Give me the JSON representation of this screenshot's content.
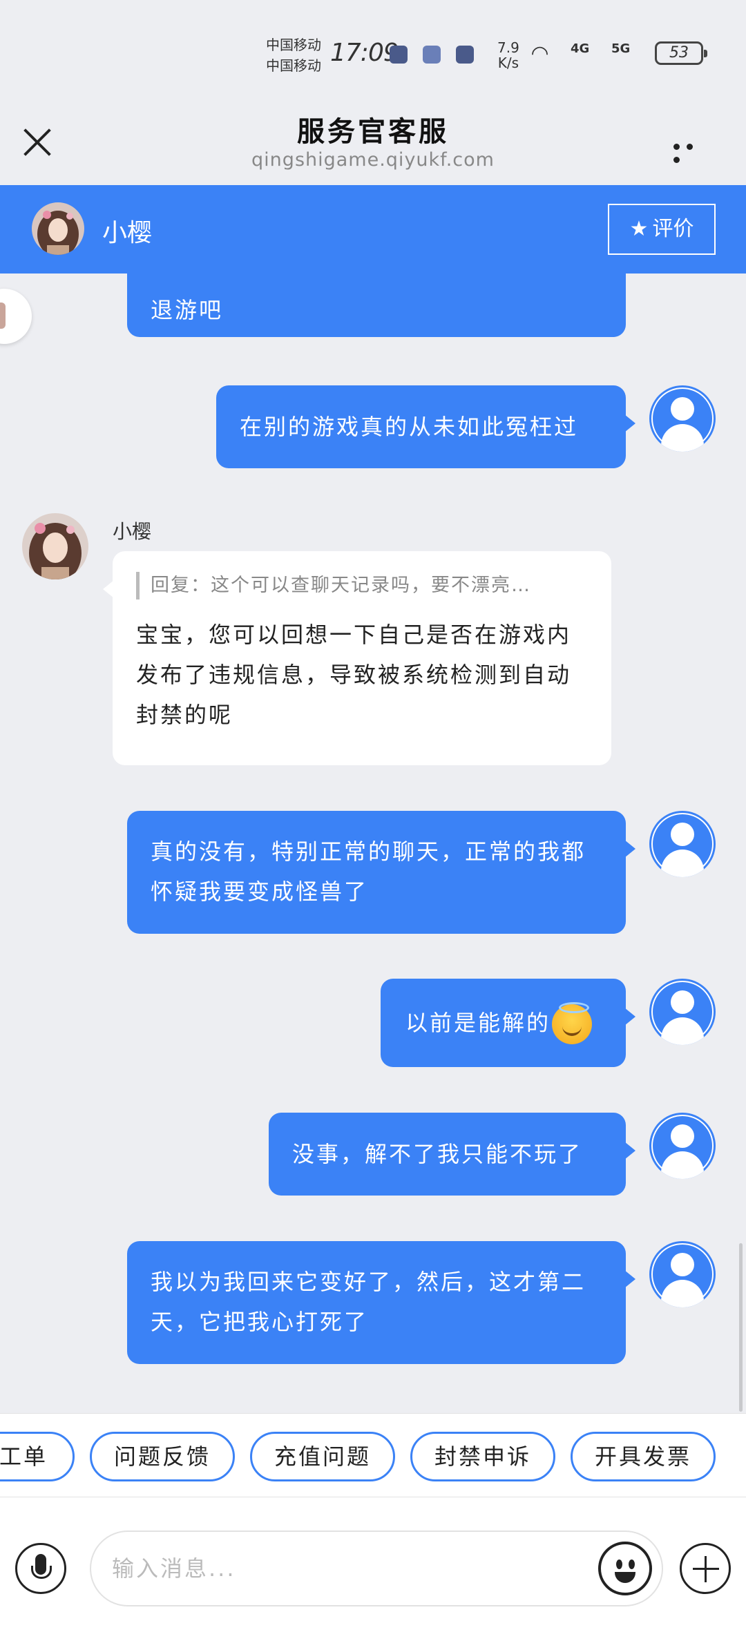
{
  "status_bar": {
    "carrier1": "中国移动",
    "carrier2": "中国移动",
    "time": "17:09",
    "net_speed_value": "7.9",
    "net_speed_unit": "K/s",
    "signal1": "4G",
    "signal2": "5G",
    "battery": "53"
  },
  "header": {
    "title": "服务官客服",
    "url": "qingshigame.qiyukf.com"
  },
  "agent_bar": {
    "name": "小樱",
    "rate_label": "评价"
  },
  "messages": [
    {
      "side": "right",
      "text": "退游吧"
    },
    {
      "side": "right",
      "text": "在别的游戏真的从未如此冤枉过"
    },
    {
      "side": "left",
      "sender": "小樱",
      "quote": "回复：这个可以查聊天记录吗，要不漂亮…",
      "text": "宝宝，您可以回想一下自己是否在游戏内发布了违规信息，导致被系统检测到自动封禁的呢"
    },
    {
      "side": "right",
      "text": "真的没有，特别正常的聊天，正常的我都怀疑我要变成怪兽了"
    },
    {
      "side": "right",
      "text": "以前是能解的",
      "emoji": "smiling-face-with-halo"
    },
    {
      "side": "right",
      "text": "没事，解不了我只能不玩了"
    },
    {
      "side": "right",
      "text": "我以为我回来它变好了，然后，这才第二天，它把我心打死了"
    }
  ],
  "quick_replies": [
    "工单",
    "问题反馈",
    "充值问题",
    "封禁申诉",
    "开具发票"
  ],
  "input": {
    "placeholder": "输入消息..."
  },
  "colors": {
    "accent": "#3b82f6",
    "background": "#edeef2"
  }
}
